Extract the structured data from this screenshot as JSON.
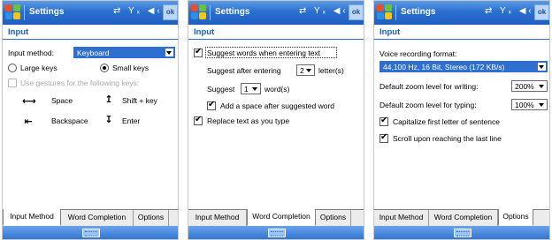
{
  "title": "Settings",
  "ok_label": "ok",
  "status_glyphs": "⇄ Yₓ ◀‹",
  "section": "Input",
  "tabs": [
    "Input Method",
    "Word Completion",
    "Options"
  ],
  "screen1": {
    "input_method_label": "Input method:",
    "input_method_value": "Keyboard",
    "large_keys": "Large keys",
    "small_keys": "Small keys",
    "selected_key_size": "Small keys",
    "gestures_label": "Use gestures for the following keys:",
    "gestures": {
      "space": "Space",
      "shift": "Shift + key",
      "backspace": "Backspace",
      "enter": "Enter"
    }
  },
  "screen2": {
    "suggest_words": "Suggest words when entering text",
    "suggest_after_label": "Suggest after entering",
    "suggest_after_value": "2",
    "letters_label": "letter(s)",
    "suggest_label": "Suggest",
    "suggest_value": "1",
    "words_label": "word(s)",
    "add_space": "Add a space after suggested word",
    "replace_text": "Replace text as you type"
  },
  "screen3": {
    "voice_format_label": "Voice recording format:",
    "voice_format_value": "44,100 Hz, 16 Bit, Stereo (172 KB/s)",
    "zoom_writing_label": "Default zoom level for writing:",
    "zoom_writing_value": "200%",
    "zoom_typing_label": "Default zoom level for typing:",
    "zoom_typing_value": "100%",
    "capitalize": "Capitalize first letter of sentence",
    "scroll": "Scroll upon reaching the last line"
  },
  "colors": {
    "titlebar": "#2a6fd0",
    "accent": "#1f5fc0",
    "selection": "#2f6fd0"
  }
}
